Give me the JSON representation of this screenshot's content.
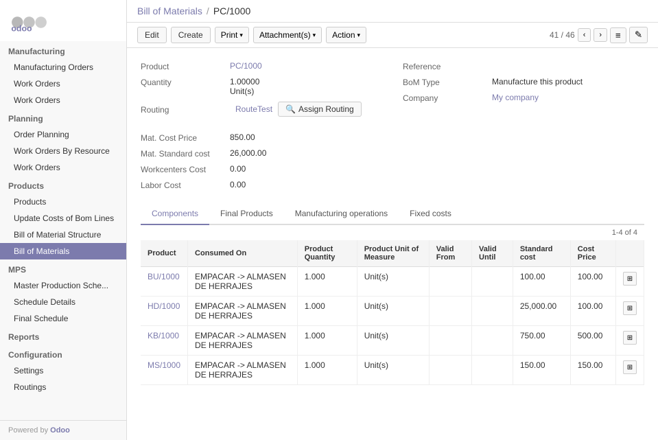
{
  "sidebar": {
    "logo_text": "odoo",
    "sections": [
      {
        "header": "Manufacturing",
        "items": [
          {
            "label": "Manufacturing Orders",
            "active": false
          },
          {
            "label": "Work Orders",
            "active": false
          },
          {
            "label": "Work Orders",
            "active": false
          }
        ]
      },
      {
        "header": "Planning",
        "items": [
          {
            "label": "Order Planning",
            "active": false
          },
          {
            "label": "Work Orders By Resource",
            "active": false
          },
          {
            "label": "Work Orders",
            "active": false
          }
        ]
      },
      {
        "header": "Products",
        "items": [
          {
            "label": "Products",
            "active": false
          },
          {
            "label": "Update Costs of Bom Lines",
            "active": false
          },
          {
            "label": "Bill of Material Structure",
            "active": false
          },
          {
            "label": "Bill of Materials",
            "active": true
          }
        ]
      },
      {
        "header": "MPS",
        "items": [
          {
            "label": "Master Production Sche...",
            "active": false
          },
          {
            "label": "Schedule Details",
            "active": false
          },
          {
            "label": "Final Schedule",
            "active": false
          }
        ]
      },
      {
        "header": "Reports",
        "items": []
      },
      {
        "header": "Configuration",
        "items": [
          {
            "label": "Settings",
            "active": false
          },
          {
            "label": "Routings",
            "active": false
          }
        ]
      }
    ],
    "footer": "Powered by Odoo"
  },
  "breadcrumb": {
    "parent": "Bill of Materials",
    "separator": "/",
    "current": "PC/1000"
  },
  "toolbar": {
    "edit_label": "Edit",
    "create_label": "Create",
    "print_label": "Print",
    "attachments_label": "Attachment(s)",
    "action_label": "Action",
    "pagination_current": "41",
    "pagination_total": "46",
    "list_icon": "≡",
    "edit_icon": "✎"
  },
  "form": {
    "product_label": "Product",
    "product_value": "PC/1000",
    "quantity_label": "Quantity",
    "quantity_value": "1.00000",
    "quantity_unit": "Unit(s)",
    "routing_label": "Routing",
    "routing_value": "RouteTest",
    "assign_routing_label": "Assign Routing",
    "reference_label": "Reference",
    "reference_value": "",
    "bom_type_label": "BoM Type",
    "bom_type_value": "Manufacture this product",
    "company_label": "Company",
    "company_value": "My company",
    "mat_cost_price_label": "Mat. Cost Price",
    "mat_cost_price_value": "850.00",
    "mat_standard_cost_label": "Mat. Standard cost",
    "mat_standard_cost_value": "26,000.00",
    "workcenters_cost_label": "Workcenters Cost",
    "workcenters_cost_value": "0.00",
    "labor_cost_label": "Labor Cost",
    "labor_cost_value": "0.00"
  },
  "tabs": [
    {
      "label": "Components",
      "active": true
    },
    {
      "label": "Final Products",
      "active": false
    },
    {
      "label": "Manufacturing operations",
      "active": false
    },
    {
      "label": "Fixed costs",
      "active": false
    }
  ],
  "table": {
    "count_label": "1-4 of 4",
    "columns": [
      {
        "label": "Product"
      },
      {
        "label": "Consumed On"
      },
      {
        "label": "Product Quantity"
      },
      {
        "label": "Product Unit of Measure"
      },
      {
        "label": "Valid From"
      },
      {
        "label": "Valid Until"
      },
      {
        "label": "Standard cost"
      },
      {
        "label": "Cost Price"
      },
      {
        "label": ""
      }
    ],
    "rows": [
      {
        "product": "BU/1000",
        "consumed_on": "EMPACAR -> ALMASEN DE HERRAJES",
        "quantity": "1.000",
        "uom": "Unit(s)",
        "valid_from": "",
        "valid_until": "",
        "standard_cost": "100.00",
        "cost_price": "100.00"
      },
      {
        "product": "HD/1000",
        "consumed_on": "EMPACAR -> ALMASEN DE HERRAJES",
        "quantity": "1.000",
        "uom": "Unit(s)",
        "valid_from": "",
        "valid_until": "",
        "standard_cost": "25,000.00",
        "cost_price": "100.00"
      },
      {
        "product": "KB/1000",
        "consumed_on": "EMPACAR -> ALMASEN DE HERRAJES",
        "quantity": "1.000",
        "uom": "Unit(s)",
        "valid_from": "",
        "valid_until": "",
        "standard_cost": "750.00",
        "cost_price": "500.00"
      },
      {
        "product": "MS/1000",
        "consumed_on": "EMPACAR -> ALMASEN DE HERRAJES",
        "quantity": "1.000",
        "uom": "Unit(s)",
        "valid_from": "",
        "valid_until": "",
        "standard_cost": "150.00",
        "cost_price": "150.00"
      }
    ]
  }
}
